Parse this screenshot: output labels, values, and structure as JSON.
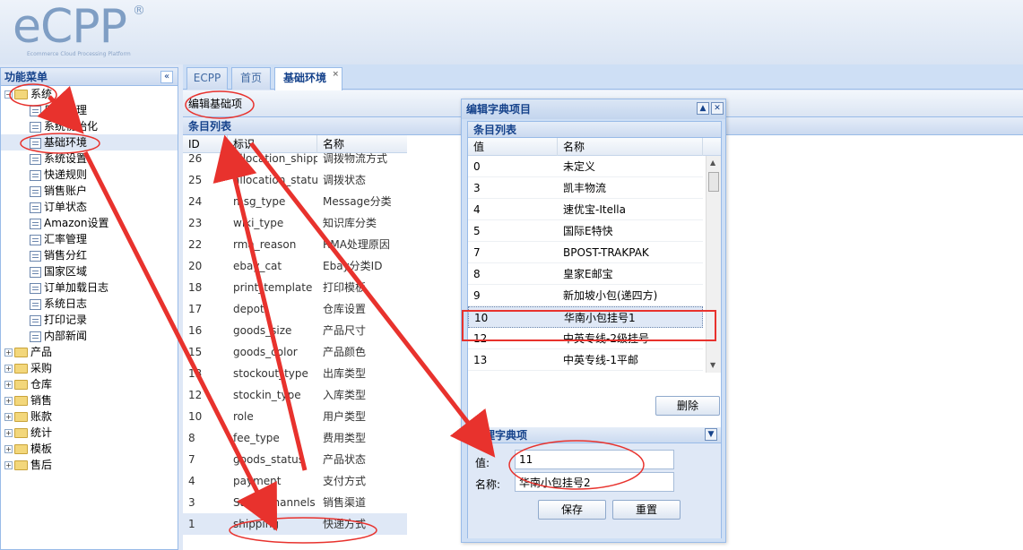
{
  "logo": {
    "text": "eCPP",
    "reg": "®",
    "subtitle": "Ecommerce Cloud Processing Platform"
  },
  "menu": {
    "title": "功能菜单",
    "collapse_icon": "«",
    "system": {
      "label": "系统",
      "children": [
        "用户管理",
        "系统初始化",
        "基础环境",
        "系统设置",
        "快递规则",
        "销售账户",
        "订单状态",
        "Amazon设置",
        "汇率管理",
        "销售分红",
        "国家区域",
        "订单加载日志",
        "系统日志",
        "打印记录",
        "内部新闻"
      ]
    },
    "others": [
      "产品",
      "采购",
      "仓库",
      "销售",
      "账款",
      "统计",
      "模板",
      "售后"
    ]
  },
  "tabs": [
    {
      "label": "ECPP"
    },
    {
      "label": "首页"
    },
    {
      "label": "基础环境",
      "close": "×"
    }
  ],
  "toolbar": {
    "edit_label": "编辑基础项"
  },
  "grid": {
    "title": "条目列表",
    "columns": [
      "ID",
      "标识",
      "名称"
    ],
    "rows": [
      [
        "26",
        "allocation_shipping",
        "调拨物流方式"
      ],
      [
        "25",
        "allocation_status",
        "调拨状态"
      ],
      [
        "24",
        "msg_type",
        "Message分类"
      ],
      [
        "23",
        "wiki_type",
        "知识库分类"
      ],
      [
        "22",
        "rma_reason",
        "RMA处理原因"
      ],
      [
        "20",
        "ebay_cat",
        "Ebay分类ID"
      ],
      [
        "18",
        "print_template",
        "打印模板"
      ],
      [
        "17",
        "depot",
        "仓库设置"
      ],
      [
        "16",
        "goods_size",
        "产品尺寸"
      ],
      [
        "15",
        "goods_color",
        "产品颜色"
      ],
      [
        "13",
        "stockout_type",
        "出库类型"
      ],
      [
        "12",
        "stockin_type",
        "入库类型"
      ],
      [
        "10",
        "role",
        "用户类型"
      ],
      [
        "8",
        "fee_type",
        "费用类型"
      ],
      [
        "7",
        "goods_status",
        "产品状态"
      ],
      [
        "4",
        "payment",
        "支付方式"
      ],
      [
        "3",
        "Sales_channels",
        "销售渠道"
      ],
      [
        "1",
        "shipping",
        "快递方式"
      ]
    ]
  },
  "dialog": {
    "title": "编辑字典项目",
    "list_title": "条目列表",
    "columns": [
      "值",
      "名称"
    ],
    "rows": [
      [
        "0",
        "未定义"
      ],
      [
        "3",
        "凯丰物流"
      ],
      [
        "4",
        "速优宝-Itella"
      ],
      [
        "5",
        "国际E特快"
      ],
      [
        "7",
        "BPOST-TRAKPAK"
      ],
      [
        "8",
        "皇家E邮宝"
      ],
      [
        "9",
        "新加坡小包(递四方)"
      ],
      [
        "10",
        "华南小包挂号1"
      ],
      [
        "12",
        "中英专线-2级挂号"
      ],
      [
        "13",
        "中英专线-1平邮"
      ]
    ],
    "delete_label": "删除",
    "manage_title": "管理字典项",
    "value_label": "值:",
    "value": "11",
    "name_label": "名称:",
    "name_value": "华南小包挂号2",
    "save_label": "保存",
    "reset_label": "重置"
  },
  "colors": {
    "accent": "#15428b",
    "border": "#99bbe8",
    "annotation": "#e8322d"
  }
}
